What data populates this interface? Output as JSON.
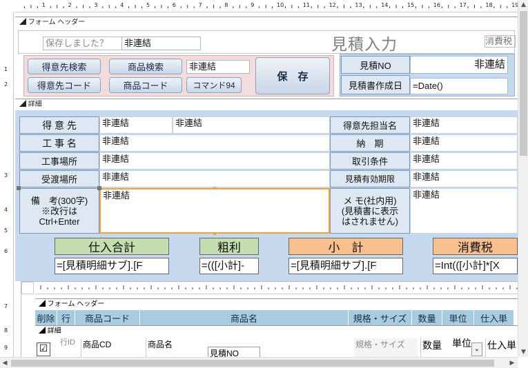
{
  "ruler": {
    "top_ticks": [
      "1",
      "2",
      "3",
      "4",
      "5",
      "6",
      "7",
      "8",
      "9",
      "10",
      "11",
      "12",
      "13",
      "14",
      "15",
      "16",
      "17",
      "18",
      "19"
    ],
    "left_ticks": [
      "1",
      "2",
      "3",
      "4",
      "5",
      "6",
      "7",
      "8",
      "9"
    ]
  },
  "sections": {
    "form_header": "フォーム ヘッダー",
    "detail": "詳細"
  },
  "header": {
    "saved_prompt": "保存しました？",
    "unbound1": "非連結",
    "title": "見積入力",
    "tax_label": "消費税",
    "btn_customer_search": "得意先検索",
    "btn_product_search": "商品検索",
    "unbound2": "非連結",
    "btn_save": "保　存",
    "btn_customer_code": "得意先コード",
    "btn_product_code": "商品コード",
    "btn_command94": "コマンド94",
    "quote_no_label": "見積NO",
    "quote_no_value": "非連結",
    "quote_date_label": "見積書作成日",
    "quote_date_value": "=Date()"
  },
  "detail": {
    "customer_label": "得 意 先",
    "customer_value1": "非連結",
    "customer_value2": "非連結",
    "customer_rep_label": "得意先担当名",
    "customer_rep_value": "非連結",
    "project_label": "工 事 名",
    "project_value": "非連結",
    "delivery_label": "納　期",
    "delivery_value": "非連結",
    "site_label": "工事場所",
    "site_value": "非連結",
    "terms_label": "取引条件",
    "terms_value": "非連結",
    "handover_label": "受渡場所",
    "handover_value": "非連結",
    "validity_label": "見積有効期限",
    "validity_value": "非連結",
    "remarks_label_l1": "備　考(300字)",
    "remarks_label_l2": "※改行は",
    "remarks_label_l3": "Ctrl+Enter",
    "remarks_value": "非連結",
    "memo_label_l1": "メ モ(社内用)",
    "memo_label_l2": "(見積書に表示",
    "memo_label_l3": "はされません)",
    "memo_value": "非連結"
  },
  "summary": {
    "purchase_total_label": "仕入合計",
    "purchase_total_value": "=[見積明細サブ].[F",
    "gross_profit_label": "粗利",
    "gross_profit_value": "=(([小計]-",
    "subtotal_label": "小　計",
    "subtotal_value": "=[見積明細サブ].[F",
    "tax_label": "消費税",
    "tax_value": "=Int(([小計]*[X"
  },
  "subform": {
    "form_header": "フォーム ヘッダー",
    "detail": "詳細",
    "columns": [
      "削除",
      "行",
      "商品コード",
      "商品名",
      "規格・サイズ",
      "数量",
      "単位",
      "仕入単"
    ],
    "row_line_no": "行ID",
    "row_product_cd": "商品CD",
    "row_product_name": "商品名",
    "row_quote_no": "見積NO",
    "row_spec": "規格・サイズ",
    "row_qty": "数量",
    "row_unit": "単位",
    "row_cost": "仕入単"
  },
  "colors": {
    "label_bg": "#dde8f3",
    "header_bg": "#f2dcdc",
    "purchase_bg": "#c5deb0",
    "subtotal_bg": "#f9c08f",
    "detail_bg": "#c7d9ee",
    "selection": "#f4a23a",
    "sub_header": "#a9cbe0"
  }
}
